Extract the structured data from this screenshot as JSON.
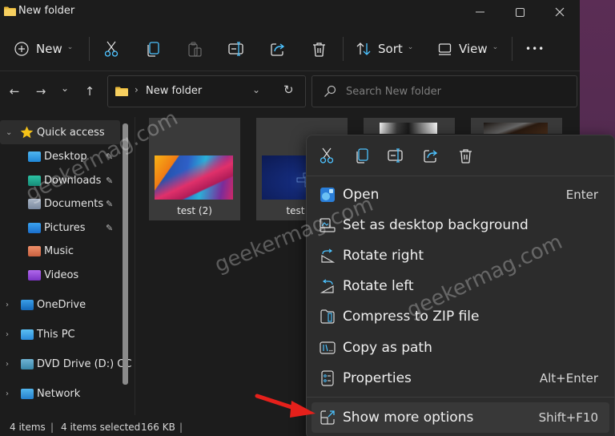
{
  "window": {
    "title": "New folder",
    "controls": {
      "minimize": "—",
      "maximize": "☐",
      "close": "✕"
    }
  },
  "commandbar": {
    "new_label": "New",
    "sort_label": "Sort",
    "view_label": "View",
    "more_label": "•••",
    "icons": [
      "cut-icon",
      "copy-icon",
      "paste-icon",
      "rename-icon",
      "share-icon",
      "delete-icon"
    ]
  },
  "navigation": {
    "back": "←",
    "forward": "→",
    "recent": "⌄",
    "up": "↑",
    "address": {
      "separator": "›",
      "path": "New folder",
      "dropdown": "⌄",
      "refresh": "↻"
    },
    "search": {
      "placeholder": "Search New folder",
      "value": ""
    }
  },
  "sidebar": {
    "items": [
      {
        "label": "Quick access",
        "expander": "⌄",
        "icon": "star-icon",
        "color": "#f5c218",
        "selected": true
      },
      {
        "label": "Desktop",
        "icon": "desktop-folder-icon",
        "color": "#2e9ee6",
        "pinned": true
      },
      {
        "label": "Downloads",
        "icon": "downloads-folder-icon",
        "color": "#1fa88f",
        "pinned": true
      },
      {
        "label": "Documents",
        "icon": "documents-folder-icon",
        "color": "#8c9bb0",
        "pinned": true
      },
      {
        "label": "Pictures",
        "icon": "pictures-folder-icon",
        "color": "#2b8fe0",
        "pinned": true
      },
      {
        "label": "Music",
        "icon": "music-folder-icon",
        "color": "#e07a5a",
        "pinned": false
      },
      {
        "label": "Videos",
        "icon": "videos-folder-icon",
        "color": "#9a4ed8",
        "pinned": false
      },
      {
        "label": "OneDrive",
        "expander": "›",
        "icon": "onedrive-icon",
        "color": "#1e88d8"
      },
      {
        "label": "This PC",
        "expander": "›",
        "icon": "this-pc-icon",
        "color": "#3aa6e6"
      },
      {
        "label": "DVD Drive (D:) CC",
        "expander": "›",
        "icon": "dvd-drive-icon",
        "color": "#46a0c8"
      },
      {
        "label": "Network",
        "expander": "›",
        "icon": "network-icon",
        "color": "#3aa0d8"
      }
    ],
    "pin_glyph": "📌"
  },
  "files": [
    {
      "name": "test (2)",
      "thumb": "abstract-colorful"
    },
    {
      "name": "test",
      "thumb": "blue-bricks"
    },
    {
      "name": "",
      "thumb": "bw-photo"
    },
    {
      "name": "",
      "thumb": "dark-photo"
    }
  ],
  "statusbar": {
    "count": "4 items",
    "sep": "|",
    "selected": "4 items selected",
    "size": "166 KB",
    "sep2": "|"
  },
  "context_menu": {
    "toolbar": [
      "cut-icon",
      "copy-icon",
      "rename-icon",
      "share-icon",
      "delete-icon"
    ],
    "items": [
      {
        "label": "Open",
        "shortcut": "Enter",
        "icon": "photos-app-icon"
      },
      {
        "label": "Set as desktop background",
        "shortcut": "",
        "icon": "desktop-background-icon"
      },
      {
        "label": "Rotate right",
        "shortcut": "",
        "icon": "rotate-right-icon"
      },
      {
        "label": "Rotate left",
        "shortcut": "",
        "icon": "rotate-left-icon"
      },
      {
        "label": "Compress to ZIP file",
        "shortcut": "",
        "icon": "zip-icon"
      },
      {
        "label": "Copy as path",
        "shortcut": "",
        "icon": "copy-path-icon"
      },
      {
        "label": "Properties",
        "shortcut": "Alt+Enter",
        "icon": "properties-icon"
      },
      {
        "label": "Show more options",
        "shortcut": "Shift+F10",
        "icon": "show-more-icon",
        "highlighted": true
      }
    ]
  },
  "watermark": "geekermag.com",
  "colors": {
    "accent": "#4cc2ff",
    "annotation_arrow": "#e5201b"
  }
}
